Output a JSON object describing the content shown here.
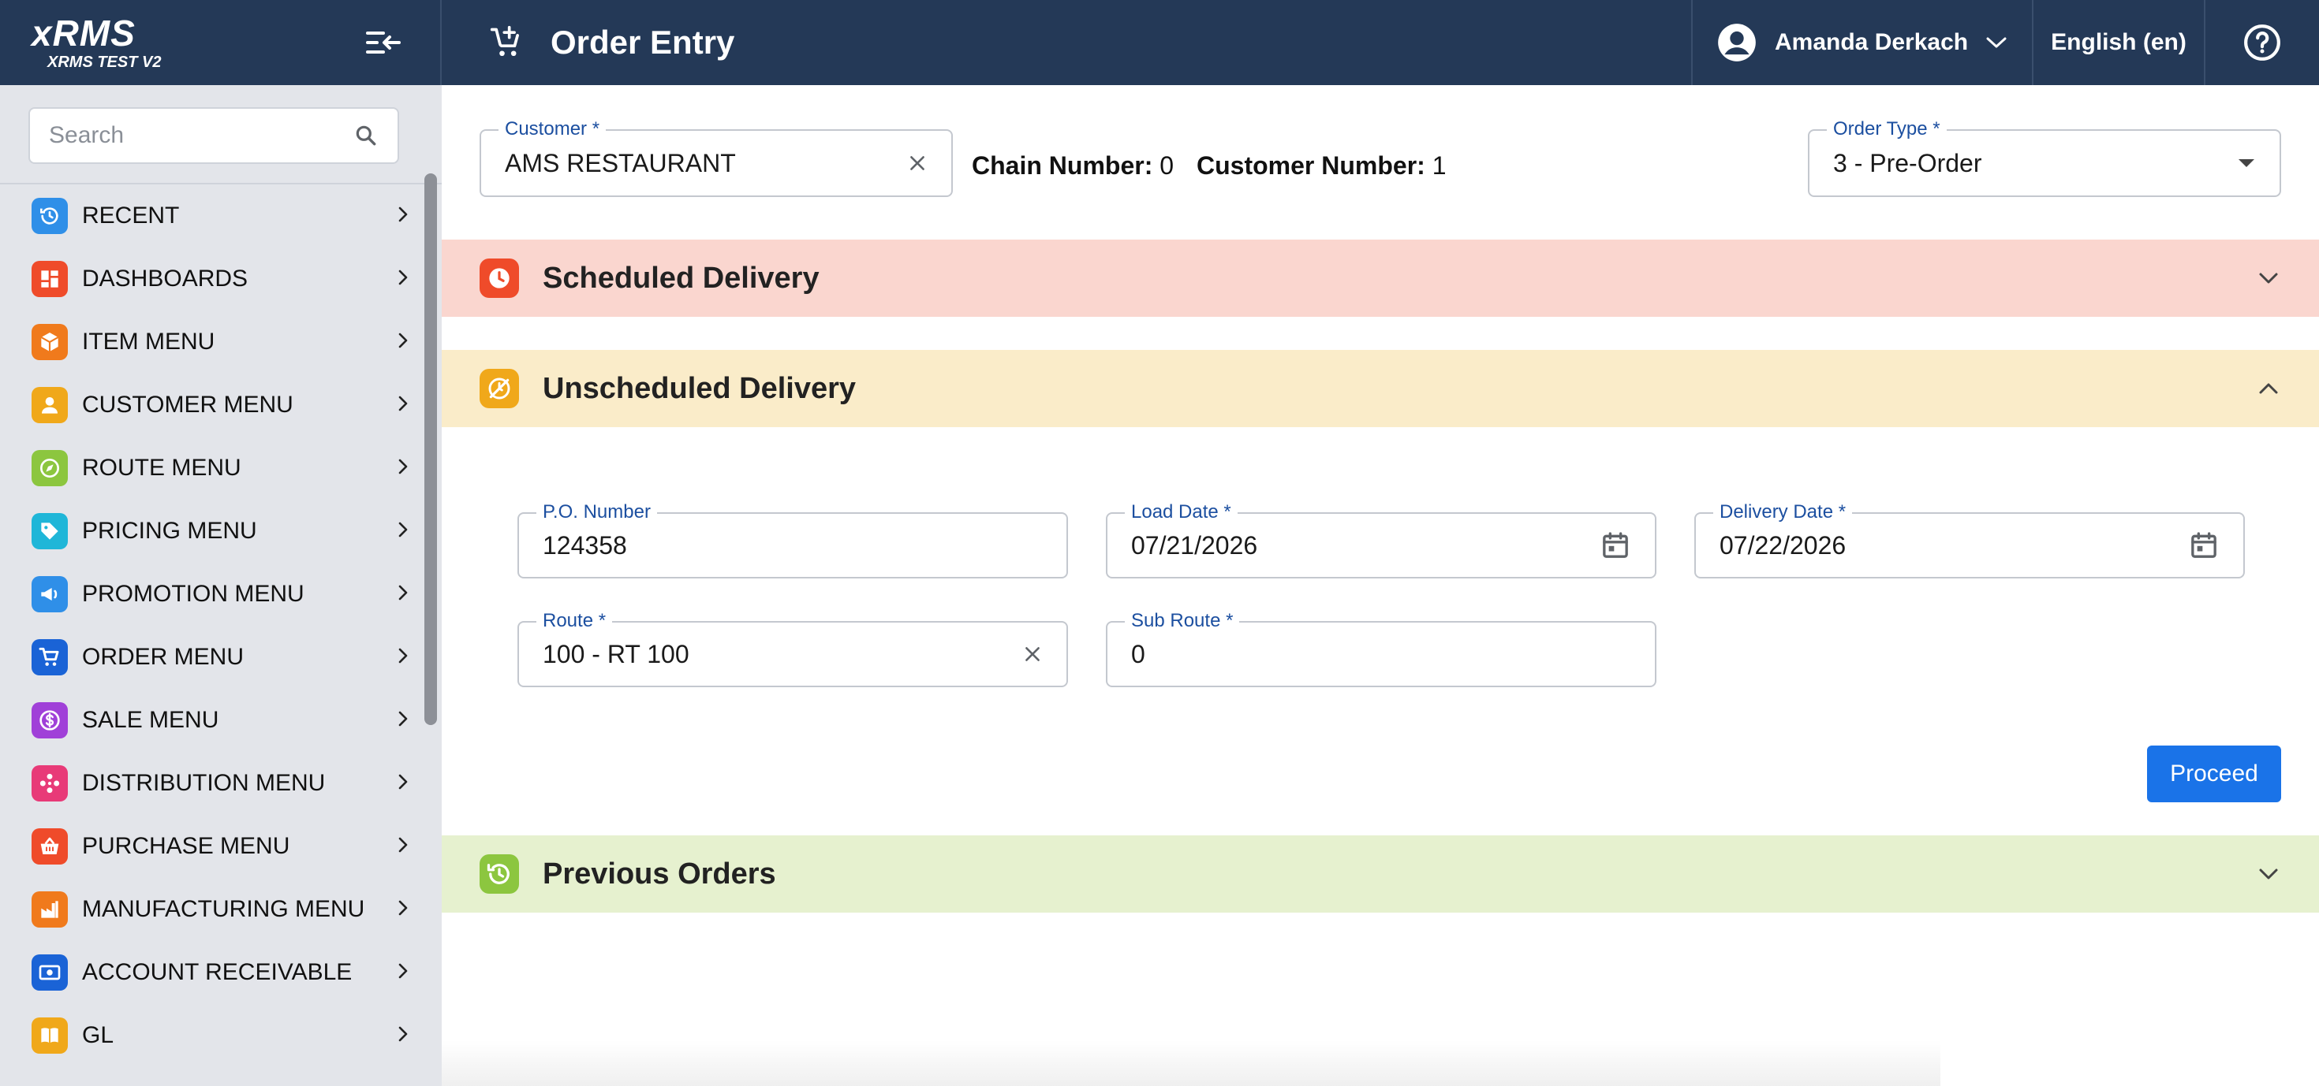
{
  "brand": {
    "logo": "xRMS",
    "subtitle": "XRMS TEST V2"
  },
  "header": {
    "title": "Order Entry",
    "user_name": "Amanda Derkach",
    "language": "English (en)"
  },
  "sidebar": {
    "search_placeholder": "Search",
    "items": [
      {
        "label": "RECENT",
        "icon": "history-icon",
        "color": "#2f8fe8"
      },
      {
        "label": "DASHBOARDS",
        "icon": "dashboard-icon",
        "color": "#ef4b2a"
      },
      {
        "label": "ITEM MENU",
        "icon": "box-icon",
        "color": "#f07a1c"
      },
      {
        "label": "CUSTOMER MENU",
        "icon": "person-icon",
        "color": "#f0a81a"
      },
      {
        "label": "ROUTE MENU",
        "icon": "compass-icon",
        "color": "#8cc63f"
      },
      {
        "label": "PRICING MENU",
        "icon": "price-tag-icon",
        "color": "#1fb6d8"
      },
      {
        "label": "PROMOTION MENU",
        "icon": "megaphone-icon",
        "color": "#2f8fe8"
      },
      {
        "label": "ORDER MENU",
        "icon": "cart-icon",
        "color": "#1a63d6"
      },
      {
        "label": "SALE MENU",
        "icon": "dollar-icon",
        "color": "#a040d8"
      },
      {
        "label": "DISTRIBUTION MENU",
        "icon": "distribution-icon",
        "color": "#e83a78"
      },
      {
        "label": "PURCHASE MENU",
        "icon": "basket-icon",
        "color": "#ef4b2a"
      },
      {
        "label": "MANUFACTURING MENU",
        "icon": "factory-icon",
        "color": "#f07a1c"
      },
      {
        "label": "ACCOUNT RECEIVABLE",
        "icon": "money-icon",
        "color": "#1a63d6"
      },
      {
        "label": "GL",
        "icon": "book-icon",
        "color": "#f0a81a"
      }
    ]
  },
  "customer": {
    "label": "Customer *",
    "value": "AMS RESTAURANT",
    "chain_label": "Chain Number:",
    "chain_value": "0",
    "number_label": "Customer Number:",
    "number_value": "1"
  },
  "order_type": {
    "label": "Order Type *",
    "value": "3 - Pre-Order"
  },
  "sections": {
    "scheduled": {
      "title": "Scheduled Delivery",
      "color": "#fad6cf",
      "icon_color": "#ef4b2a"
    },
    "unscheduled": {
      "title": "Unscheduled Delivery",
      "color": "#faecc9",
      "icon_color": "#f0a81a"
    },
    "previous": {
      "title": "Previous Orders",
      "color": "#e6f1cf",
      "icon_color": "#8cc63f"
    }
  },
  "form": {
    "po_number": {
      "label": "P.O. Number",
      "value": "124358"
    },
    "load_date": {
      "label": "Load Date *",
      "value": "07/21/2026"
    },
    "delivery_date": {
      "label": "Delivery Date *",
      "value": "07/22/2026"
    },
    "route": {
      "label": "Route *",
      "value": "100 - RT 100"
    },
    "sub_route": {
      "label": "Sub Route *",
      "value": "0"
    },
    "proceed_label": "Proceed"
  }
}
